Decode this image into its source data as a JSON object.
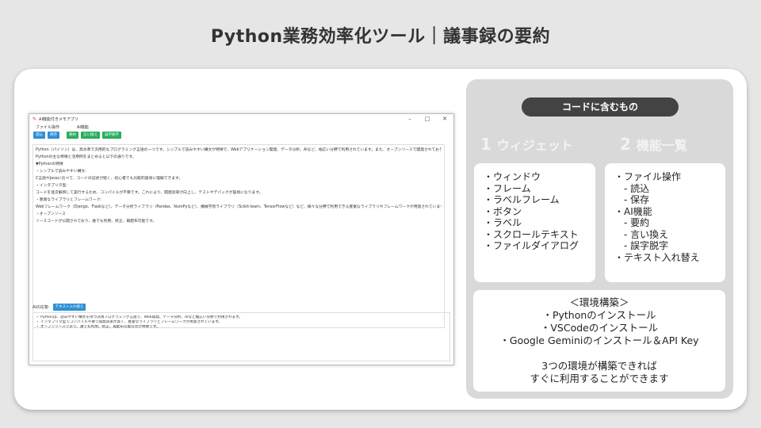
{
  "slide": {
    "title": "Python業務効率化ツール｜議事録の要約"
  },
  "app": {
    "window_title": "AI機能付きメモアプリ",
    "min": "–",
    "max": "□",
    "close": "✕",
    "menu_file_label": "ファイル操作",
    "menu_ai_label": "AI機能",
    "buttons": [
      "読込",
      "保存",
      "要約",
      "言い換え",
      "誤字脱字"
    ],
    "main_text": [
      "Python（パイソン）は、高水準で汎用的なプログラミング言語の一つです。シンプルで読みやすい構文が特徴で、Webアプリケーション開発、データ分析、AIなど、幅広い分野で利用されています。また、オープンソースで開発されており、豊富なライブラリやフレームワークが用意されているため、初心者にも比較的取り組みやすい言語です。",
      "Pythonの主な特徴と活用例をまとめると以下の通りです。",
      "",
      "▼Pythonの特徴",
      "・シンプルで読みやすい構文:",
      "C言語やJavaに比べて、コードの記述が短く、初心者でも比較的容易に理解できます。",
      "",
      "・インタプリタ型:",
      "コードを逐次解釈して実行するため、コンパイルが不要です。これにより、開発効率が向上し、テストやデバッグが容易になります。",
      "",
      "・豊富なライブラリとフレームワーク:",
      "Webフレームワーク（Django、Flaskなど）、データ分析ライブラリ（Pandas、NumPyなど）、機械学習ライブラリ（Scikit-learn、TensorFlowなど）など、様々な分野で利用できる豊富なライブラリやフレームワークが用意されています。",
      "",
      "・オープンソース",
      "ソースコードが公開されており、誰でも利用、修正、再配布可能です。"
    ],
    "ai_label": "AIの応答:",
    "ai_button": "テキスト入れ替え",
    "ai_text": [
      "・ Pythonは、読みやすい構文を持つ汎用プログラミング言語で、Web開発、データ分析、AIなど幅広い分野で利用されます。",
      "・ インタプリタ型でコンパイル不要で開発効率が高く、豊富なライブラリとフレームワークが用意されています。",
      "・ オープンソースであり、誰でも利用、修正、再配布可能な点が特徴です。"
    ]
  },
  "panel": {
    "pill": "コードに含むもの",
    "widgets_num": "1",
    "widgets_title": "ウィジェット",
    "features_num": "2",
    "features_title": "機能一覧",
    "widgets": [
      "・ウィンドウ",
      "・フレーム",
      "・ラベルフレーム",
      "・ボタン",
      "・ラベル",
      "・スクロールテキスト",
      "・ファイルダイアログ"
    ],
    "features": [
      "・ファイル操作",
      "　- 読込",
      "　- 保存",
      "・AI機能",
      "　- 要約",
      "　- 言い換え",
      "　- 誤字脱字",
      "・テキスト入れ替え"
    ],
    "env_title": "＜環境構築＞",
    "env_items": [
      "・Pythonのインストール",
      "・VSCodeのインストール",
      "・Google Geminiのインストール＆API Key"
    ],
    "env_note_1": "3つの環境が構築できれば",
    "env_note_2": "すぐに利用することができます"
  }
}
